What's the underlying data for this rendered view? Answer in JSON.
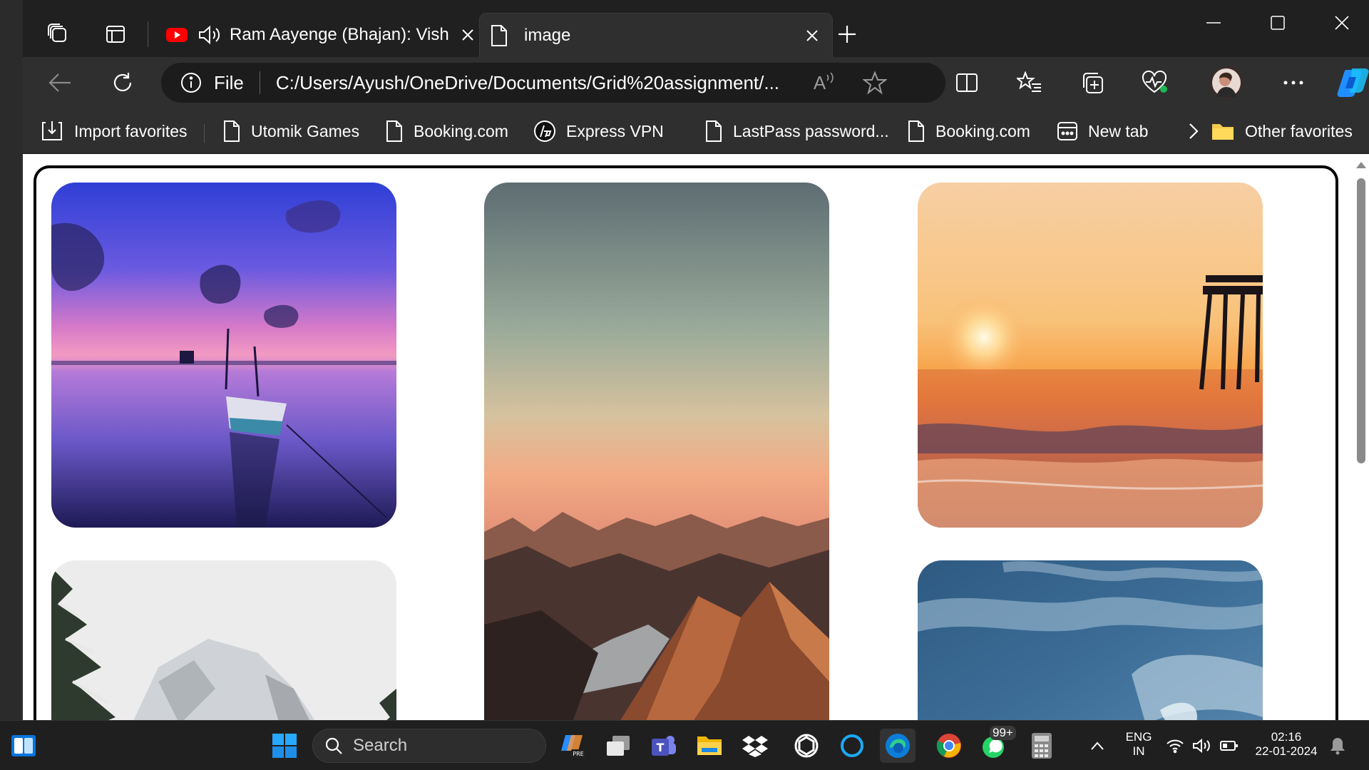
{
  "browser": {
    "tabs": [
      {
        "title": "Ram Aayenge (Bhajan): Vish",
        "state": "inactive",
        "audio": true
      },
      {
        "title": "image",
        "state": "active"
      }
    ],
    "address": {
      "scheme_label": "File",
      "url": "C:/Users/Ayush/OneDrive/Documents/Grid%20assignment/..."
    },
    "read_aloud_label": "A",
    "favorites": [
      {
        "label": "Import favorites",
        "icon": "import-icon"
      },
      {
        "label": "Utomik Games",
        "icon": "page-icon"
      },
      {
        "label": "Booking.com",
        "icon": "page-icon"
      },
      {
        "label": "Express VPN",
        "icon": "hp-logo-icon"
      },
      {
        "label": "LastPass password...",
        "icon": "page-icon"
      },
      {
        "label": "Booking.com",
        "icon": "page-icon"
      },
      {
        "label": "New tab",
        "icon": "new-tab-icon"
      }
    ],
    "other_favorites": "Other favorites",
    "accent": "#0078d4"
  },
  "page": {
    "images": [
      {
        "alt": "boat-at-purple-sunset",
        "colors": [
          "#3b4fe0",
          "#c86fb0",
          "#2a2560"
        ]
      },
      {
        "alt": "mountain-peaks-at-dusk",
        "colors": [
          "#5a6b70",
          "#e8b48e",
          "#5a3a2e"
        ]
      },
      {
        "alt": "pier-at-sunset-sea",
        "colors": [
          "#f5c99a",
          "#f08a3e",
          "#3a4a70"
        ]
      },
      {
        "alt": "snowy-forest-mountains",
        "colors": [
          "#e8e8e8",
          "#d0d2d4",
          "#505a50"
        ]
      },
      {
        "alt": "cloudy-blue-sky",
        "colors": [
          "#3a6a94",
          "#7aa6c4",
          "#9cc0d8"
        ]
      }
    ]
  },
  "taskbar": {
    "search_placeholder": "Search",
    "whatsapp_badge": "99+",
    "language": "ENG",
    "region": "IN",
    "time": "02:16",
    "date": "22-01-2024"
  }
}
